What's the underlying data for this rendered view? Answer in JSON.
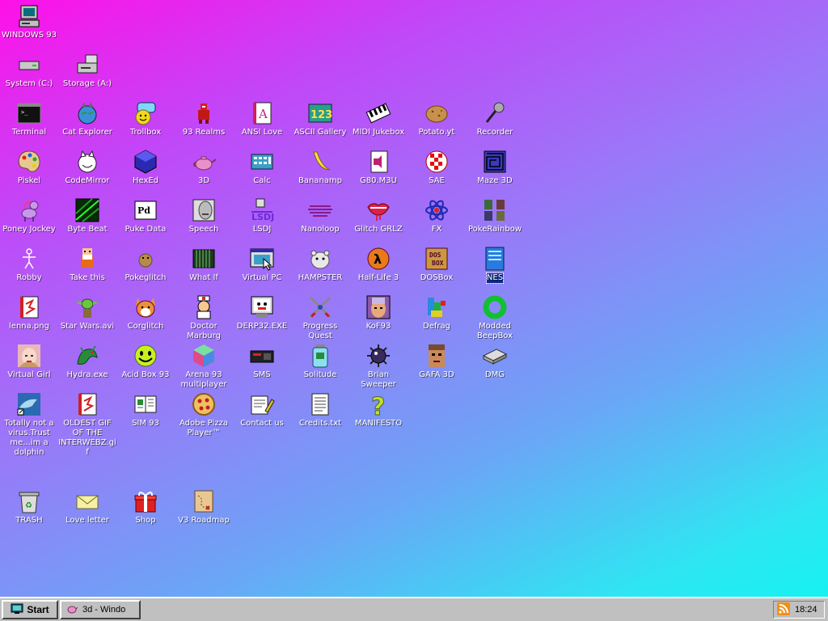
{
  "desktop": {
    "icons": {
      "windows93": "WINDOWS 93",
      "system": "System (C:)",
      "storage": "Storage (A:)",
      "terminal": "Terminal",
      "cat_explorer": "Cat Explorer",
      "trollbox": "Trollbox",
      "realms": "93 Realms",
      "ansi_love": "ANSI Love",
      "ascii_gallery": "ASCII Gallery",
      "midi_jukebox": "MIDI Jukebox",
      "potato": "Potato.yt",
      "recorder": "Recorder",
      "piskel": "Piskel",
      "codemirror": "CodeMirror",
      "hexed": "HexEd",
      "three_d": "3D",
      "calc": "Calc",
      "bananamp": "Bananamp",
      "g80m3u": "G80.M3U",
      "sae": "SAE",
      "maze3d": "Maze 3D",
      "poney": "Poney Jockey",
      "bytebeat": "Byte Beat",
      "pukedata": "Puke Data",
      "speech": "Speech",
      "lsdj": "LSDJ",
      "nanoloop": "Nanoloop",
      "glitchgrlz": "Glitch GRLZ",
      "fx": "FX",
      "pokerainbow": "PokeRainbow",
      "robby": "Robby",
      "takethis": "Take this",
      "pokeglitch": "Pokeglitch",
      "whatif": "What If",
      "virtualpc": "Virtual PC",
      "hampster": "HAMPSTER",
      "halflife3": "Half-Life 3",
      "dosbox": "DOSBox",
      "nes": "NES",
      "lenna": "lenna.png",
      "starwars": "Star Wars.avi",
      "corglitch": "Corglitch",
      "drmarburg": "Doctor Marburg",
      "derp32": "DERP32.EXE",
      "progressquest": "Progress Quest",
      "kof93": "KoF93",
      "defrag": "Defrag",
      "beepbox": "Modded BeepBox",
      "virtualgirl": "Virtual Girl",
      "hydra": "Hydra.exe",
      "acidbox": "Acid Box 93",
      "arena93": "Arena 93 multiplayer",
      "sms": "SMS",
      "solitude": "Solitude",
      "briansweeper": "Brian Sweeper",
      "gafa3d": "GAFA 3D",
      "dmg": "DMG",
      "dolphin": "Totally not a virus.Trust me...im a dolphin",
      "oldestgif": "OLDEST GIF OF THE INTERWEBZ.gif",
      "sim93": "SIM 93",
      "pizza": "Adobe Pizza Player™",
      "contact": "Contact us",
      "credits": "Credits.txt",
      "manifesto": "MANIFESTO",
      "trash": "TRASH",
      "loveletter": "Love letter",
      "shop": "Shop",
      "roadmap": "V3 Roadmap"
    }
  },
  "taskbar": {
    "start_label": "Start",
    "task_label": "3d - Windo",
    "clock": "18:24"
  }
}
